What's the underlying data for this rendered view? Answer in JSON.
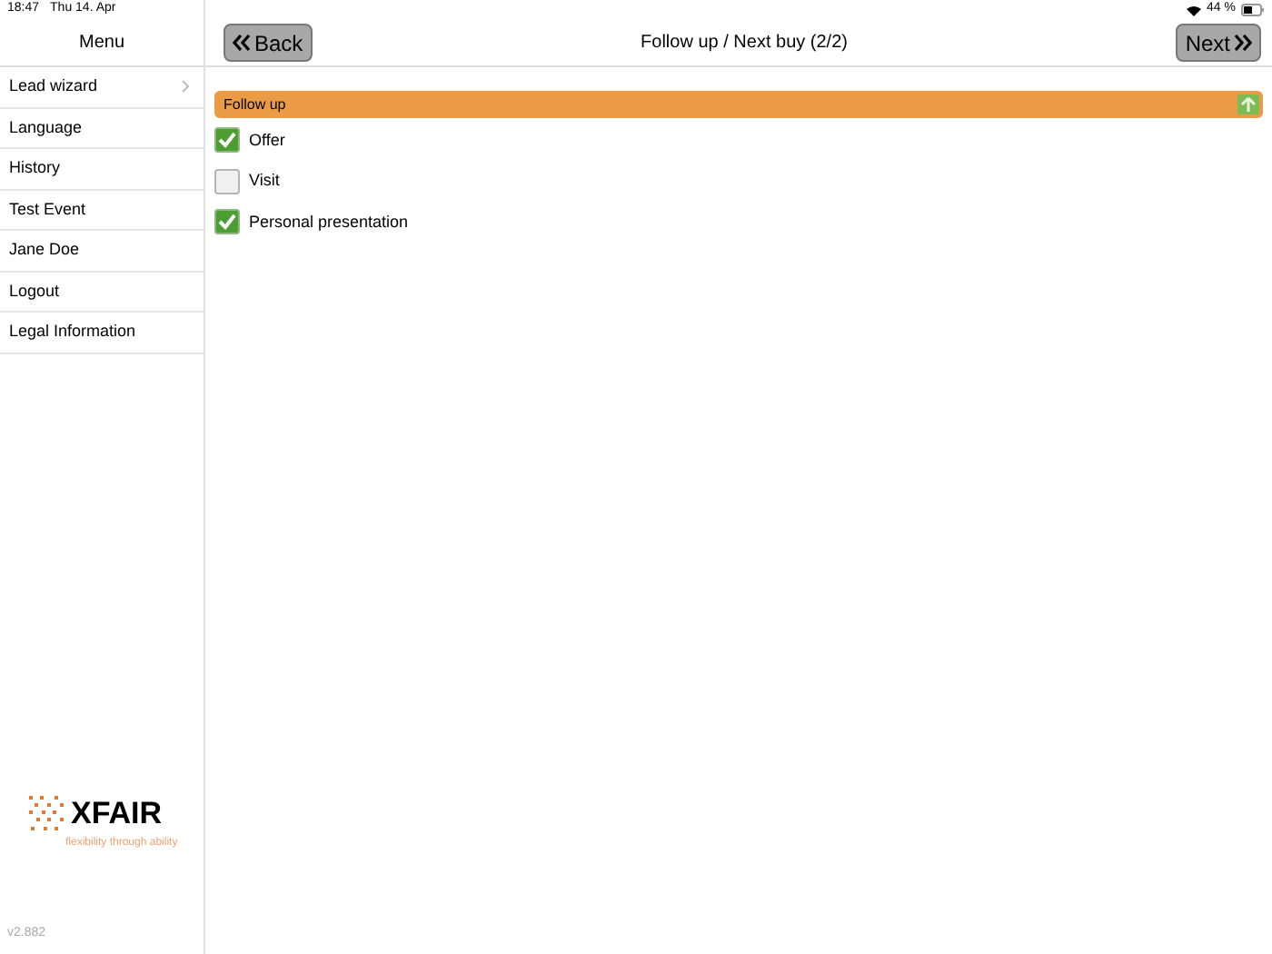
{
  "status_bar": {
    "time": "18:47",
    "date": "Thu 14. Apr",
    "battery": "44 %"
  },
  "sidebar": {
    "title": "Menu",
    "items": [
      {
        "label": "Lead wizard",
        "chevron": true
      },
      {
        "label": "Language",
        "chevron": false
      },
      {
        "label": "History",
        "chevron": false
      },
      {
        "label": "Test Event",
        "chevron": false
      },
      {
        "label": "Jane Doe",
        "chevron": false
      },
      {
        "label": "Logout",
        "chevron": false
      },
      {
        "label": "Legal Information",
        "chevron": false
      }
    ],
    "logo": {
      "name": "XFAIR",
      "tagline": "flexibility through ability"
    },
    "version": "v2.882"
  },
  "header": {
    "back": "Back",
    "title": "Follow up / Next buy (2/2)",
    "next": "Next"
  },
  "section": {
    "title": "Follow up",
    "expanded": true,
    "options": [
      {
        "label": "Offer",
        "checked": true
      },
      {
        "label": "Visit",
        "checked": false
      },
      {
        "label": "Personal presentation",
        "checked": true
      }
    ]
  }
}
